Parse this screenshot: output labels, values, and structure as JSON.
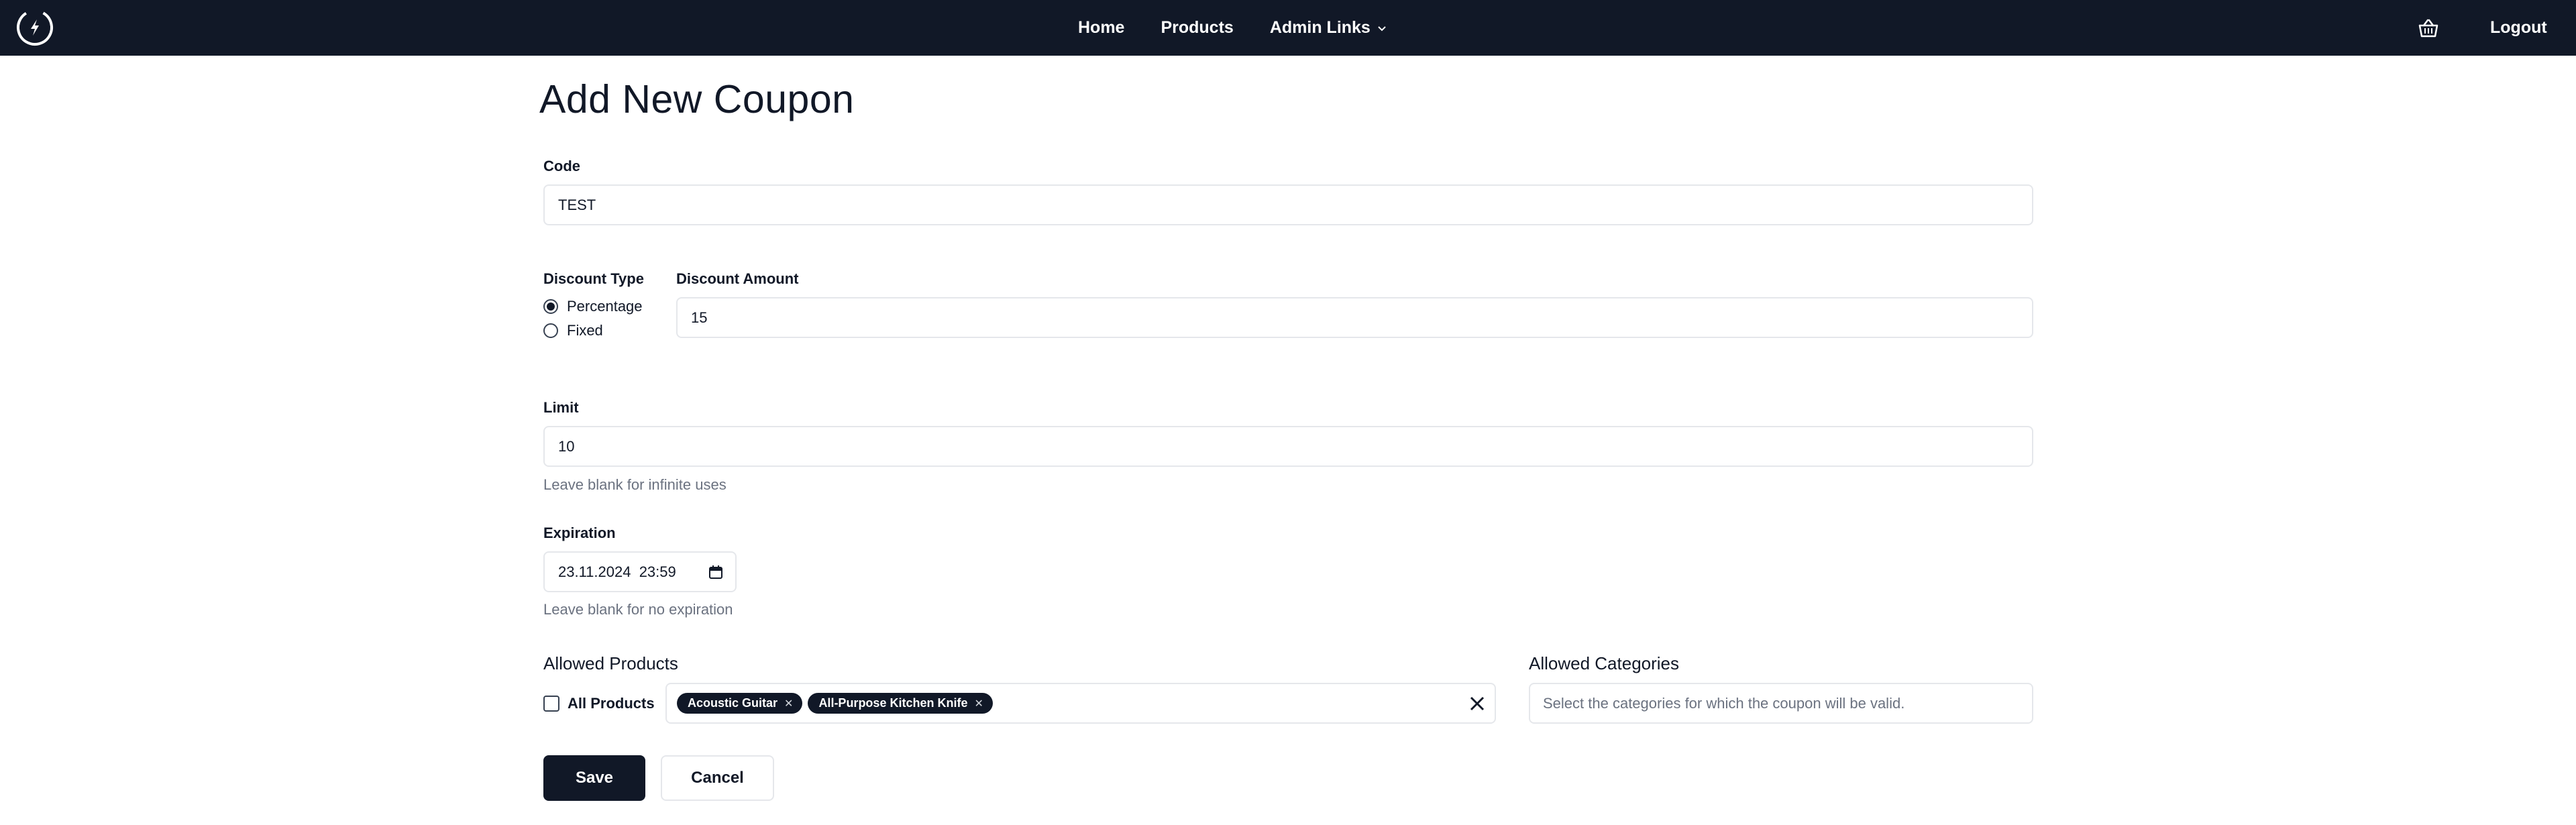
{
  "nav": {
    "home": "Home",
    "products": "Products",
    "admin_links": "Admin Links",
    "logout": "Logout"
  },
  "page": {
    "title": "Add New Coupon"
  },
  "form": {
    "code": {
      "label": "Code",
      "value": "TEST"
    },
    "discount_type": {
      "label": "Discount Type",
      "options": [
        {
          "label": "Percentage",
          "selected": true
        },
        {
          "label": "Fixed",
          "selected": false
        }
      ]
    },
    "discount_amount": {
      "label": "Discount Amount",
      "value": "15"
    },
    "limit": {
      "label": "Limit",
      "value": "10",
      "help": "Leave blank for infinite uses"
    },
    "expiration": {
      "label": "Expiration",
      "value": "23.11.2024  23:59",
      "help": "Leave blank for no expiration"
    },
    "allowed_products": {
      "title": "Allowed Products",
      "all_label": "All Products",
      "selected": [
        "Acoustic Guitar",
        "All-Purpose Kitchen Knife"
      ]
    },
    "allowed_categories": {
      "title": "Allowed Categories",
      "placeholder": "Select the categories for which the coupon will be valid."
    },
    "save_label": "Save",
    "cancel_label": "Cancel"
  },
  "colors": {
    "navbar": "#111827",
    "primary": "#111827",
    "border": "#e5e7eb",
    "help_text": "#6b7280"
  },
  "icons": [
    "logo-icon",
    "chevron-down-icon",
    "basket-icon",
    "close-icon",
    "calendar-icon",
    "chip-remove-icon"
  ]
}
